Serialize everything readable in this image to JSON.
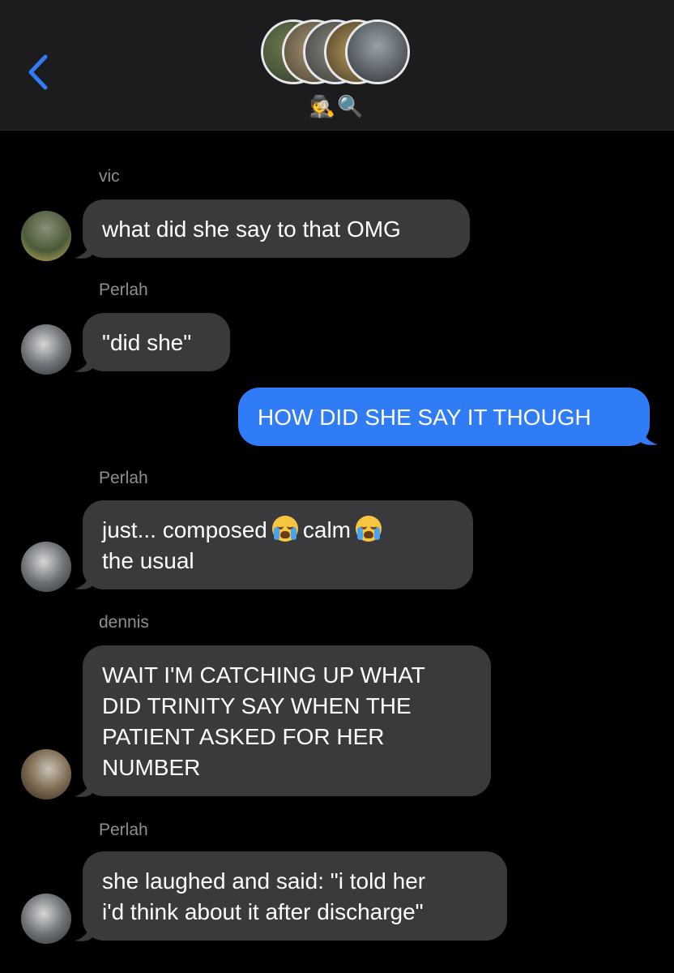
{
  "header": {
    "back_label": "<",
    "group_name": "🕵🔍",
    "group_avatars": [
      "avatar-1",
      "avatar-2",
      "avatar-3",
      "avatar-4",
      "avatar-5"
    ]
  },
  "messages": [
    {
      "sender": "vic",
      "text": "what did she say to that OMG",
      "direction": "received"
    },
    {
      "sender": "Perlah",
      "text": "\"did she\"",
      "direction": "received"
    },
    {
      "sender": "",
      "text": "HOW DID SHE SAY IT THOUGH",
      "direction": "sent"
    },
    {
      "sender": "Perlah",
      "line1": "just... composed",
      "line1_mid": "calm",
      "line2": "the usual",
      "emoji": "loudly-crying-face",
      "direction": "received"
    },
    {
      "sender": "dennis",
      "lines": [
        "WAIT I'M CATCHING UP WHAT",
        "DID TRINITY SAY WHEN THE",
        "PATIENT ASKED FOR HER",
        "NUMBER"
      ],
      "direction": "received"
    },
    {
      "sender": "Perlah",
      "lines": [
        "she laughed and said: \"i told her",
        "i'd think about it after discharge\""
      ],
      "direction": "received"
    }
  ],
  "colors": {
    "background": "#000000",
    "header": "#1c1c1e",
    "received_bubble": "#3a3a3c",
    "sent_bubble": "#2f7cf6",
    "sender_label": "#8e8e93",
    "back_chevron": "#2f7cf6"
  }
}
